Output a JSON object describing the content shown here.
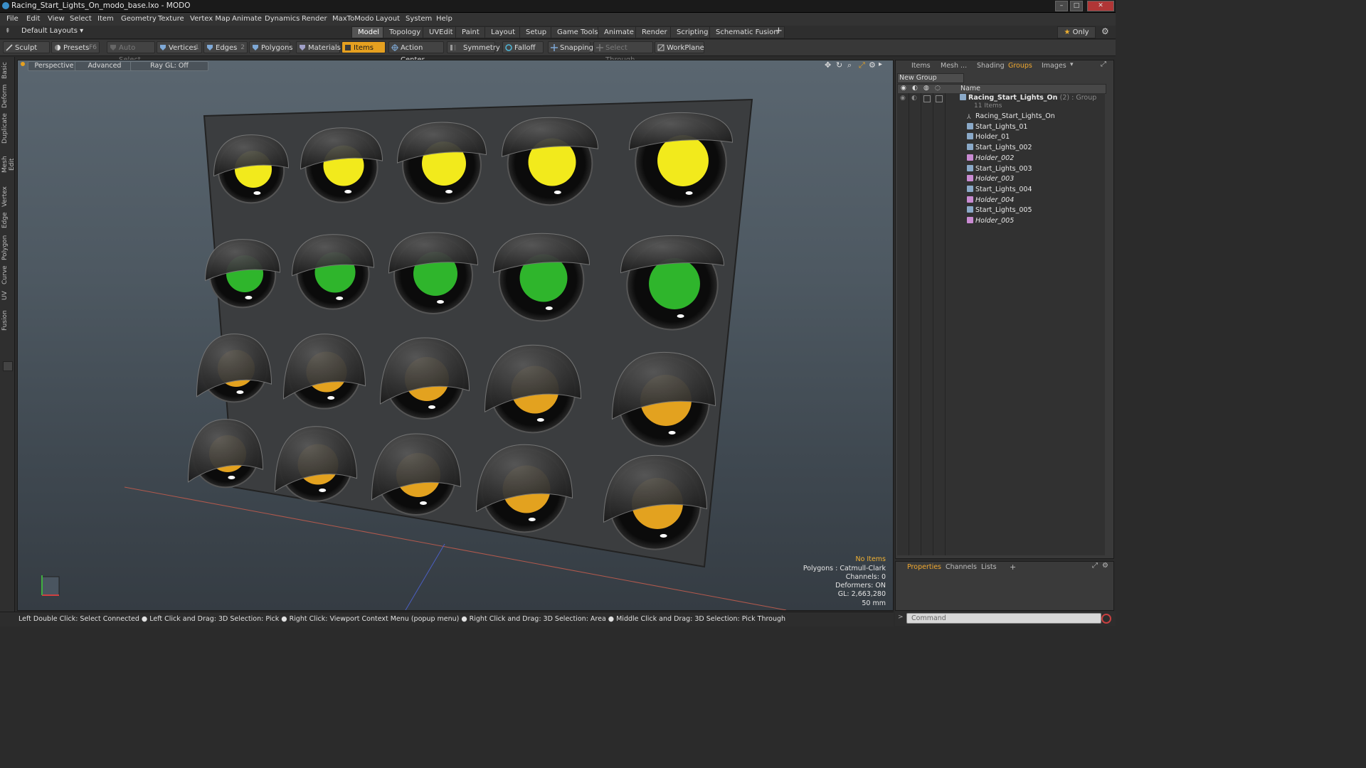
{
  "window": {
    "title": "Racing_Start_Lights_On_modo_base.lxo - MODO"
  },
  "menu": [
    "File",
    "Edit",
    "View",
    "Select",
    "Item",
    "Geometry",
    "Texture",
    "Vertex Map",
    "Animate",
    "Dynamics",
    "Render",
    "MaxToModo",
    "Layout",
    "System",
    "Help"
  ],
  "layouts": {
    "selector": "Default Layouts",
    "tabs": [
      "Model",
      "Topology",
      "UVEdit",
      "Paint",
      "Layout",
      "Setup",
      "Game Tools",
      "Animate",
      "Render",
      "Scripting",
      "Schematic Fusion"
    ],
    "active_tab": "Model",
    "only_label": "Only"
  },
  "toolbar": {
    "sculpt": "Sculpt",
    "presets": "Presets",
    "presets_key": "F6",
    "auto_select": "Auto Select",
    "vertices": "Vertices",
    "vertices_count": "1",
    "edges": "Edges",
    "edges_count": "2",
    "polygons": "Polygons",
    "materials": "Materials",
    "items": "Items",
    "action_center": "Action Center",
    "symmetry": "Symmetry",
    "falloff": "Falloff",
    "snapping": "Snapping",
    "select_through": "Select Through",
    "workplane": "WorkPlane"
  },
  "left_tabs": [
    "Basic",
    "Deform",
    "Duplicate",
    "Mesh Edit",
    "Vertex",
    "Edge",
    "Polygon",
    "Curve",
    "UV",
    "Fusion"
  ],
  "viewport": {
    "view": "Perspective",
    "shading": "Advanced",
    "raygl": "Ray GL: Off",
    "info": {
      "selection": "No Items",
      "polygons": "Polygons : Catmull-Clark",
      "channels": "Channels: 0",
      "deformers": "Deformers: ON",
      "gl": "GL: 2,663,280",
      "scale": "50 mm"
    }
  },
  "right_panel": {
    "tabs": [
      "Items",
      "Mesh ...",
      "Shading",
      "Groups",
      "Images"
    ],
    "active_tab": "Groups",
    "new_group": "New Group",
    "name_header": "Name",
    "group": {
      "name": "Racing_Start_Lights_On",
      "suffix": "(2) : Group",
      "count": "11 Items"
    },
    "items": [
      {
        "label": "Racing_Start_Lights_On",
        "kind": "locator",
        "italic": false
      },
      {
        "label": "Start_Lights_01",
        "kind": "mesh",
        "italic": false
      },
      {
        "label": "Holder_01",
        "kind": "mesh",
        "italic": false
      },
      {
        "label": "Start_Lights_002",
        "kind": "mesh",
        "italic": false
      },
      {
        "label": "Holder_002",
        "kind": "instance",
        "italic": true
      },
      {
        "label": "Start_Lights_003",
        "kind": "mesh",
        "italic": false
      },
      {
        "label": "Holder_003",
        "kind": "instance",
        "italic": true
      },
      {
        "label": "Start_Lights_004",
        "kind": "mesh",
        "italic": false
      },
      {
        "label": "Holder_004",
        "kind": "instance",
        "italic": true
      },
      {
        "label": "Start_Lights_005",
        "kind": "mesh",
        "italic": false
      },
      {
        "label": "Holder_005",
        "kind": "instance",
        "italic": true
      }
    ]
  },
  "properties_panel": {
    "tabs": [
      "Properties",
      "Channels",
      "Lists"
    ],
    "active_tab": "Properties"
  },
  "status_bar": "Left Double Click: Select Connected ● Left Click and Drag: 3D Selection: Pick ● Right Click: Viewport Context Menu (popup menu) ● Right Click and Drag: 3D Selection: Area ● Middle Click and Drag: 3D Selection: Pick Through",
  "command": {
    "placeholder": "Command"
  },
  "colors": {
    "accent": "#e5a020",
    "lamp_yellow": "#f2ea1c",
    "lamp_green": "#2fb52c",
    "lamp_amber": "#e3a21f"
  }
}
